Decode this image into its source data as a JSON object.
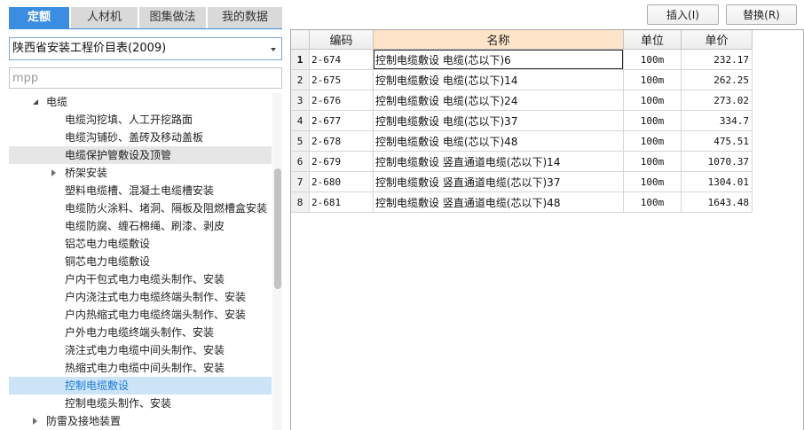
{
  "tabs": [
    {
      "label": "定额",
      "active": true
    },
    {
      "label": "人材机",
      "active": false
    },
    {
      "label": "图集做法",
      "active": false
    },
    {
      "label": "我的数据",
      "active": false
    }
  ],
  "library_select": {
    "value": "陕西省安装工程价目表(2009)",
    "icon": "chevron-down-icon"
  },
  "search": {
    "placeholder": "mpp"
  },
  "tree": {
    "items": [
      {
        "label": "电缆",
        "level": 0,
        "expander": "expanded"
      },
      {
        "label": "电缆沟挖填、人工开挖路面",
        "level": 1
      },
      {
        "label": "电缆沟铺砂、盖砖及移动盖板",
        "level": 1
      },
      {
        "label": "电缆保护管敷设及顶管",
        "level": 1,
        "state": "hover"
      },
      {
        "label": "桥架安装",
        "level": 1,
        "expander": "collapsed"
      },
      {
        "label": "塑料电缆槽、混凝土电缆槽安装",
        "level": 1
      },
      {
        "label": "电缆防火涂料、堵洞、隔板及阻燃槽盒安装",
        "level": 1
      },
      {
        "label": "电缆防腐、缠石棉绳、刷漆、剥皮",
        "level": 1
      },
      {
        "label": "铝芯电力电缆敷设",
        "level": 1
      },
      {
        "label": "铜芯电力电缆敷设",
        "level": 1
      },
      {
        "label": "户内干包式电力电缆头制作、安装",
        "level": 1
      },
      {
        "label": "户内浇注式电力电缆终端头制作、安装",
        "level": 1
      },
      {
        "label": "户内热缩式电力电缆终端头制作、安装",
        "level": 1
      },
      {
        "label": "户外电力电缆终端头制作、安装",
        "level": 1
      },
      {
        "label": "浇注式电力电缆中间头制作、安装",
        "level": 1
      },
      {
        "label": "热缩式电力电缆中间头制作、安装",
        "level": 1
      },
      {
        "label": "控制电缆敷设",
        "level": 1,
        "state": "selected"
      },
      {
        "label": "控制电缆头制作、安装",
        "level": 1
      },
      {
        "label": "防雷及接地装置",
        "level": 0,
        "expander": "collapsed"
      }
    ]
  },
  "toolbar": {
    "insert_label": "插入(I)",
    "replace_label": "替换(R)"
  },
  "table": {
    "columns": [
      {
        "key": "num",
        "label": ""
      },
      {
        "key": "code",
        "label": "编码"
      },
      {
        "key": "name",
        "label": "名称",
        "highlighted": true
      },
      {
        "key": "unit",
        "label": "单位"
      },
      {
        "key": "price",
        "label": "单价"
      }
    ],
    "rows": [
      {
        "num": "1",
        "code": "2-674",
        "name": "控制电缆敷设 电缆(芯以下)6",
        "unit": "100m",
        "price": "232.17"
      },
      {
        "num": "2",
        "code": "2-675",
        "name": "控制电缆敷设 电缆(芯以下)14",
        "unit": "100m",
        "price": "262.25"
      },
      {
        "num": "3",
        "code": "2-676",
        "name": "控制电缆敷设 电缆(芯以下)24",
        "unit": "100m",
        "price": "273.02"
      },
      {
        "num": "4",
        "code": "2-677",
        "name": "控制电缆敷设 电缆(芯以下)37",
        "unit": "100m",
        "price": "334.7"
      },
      {
        "num": "5",
        "code": "2-678",
        "name": "控制电缆敷设 电缆(芯以下)48",
        "unit": "100m",
        "price": "475.51"
      },
      {
        "num": "6",
        "code": "2-679",
        "name": "控制电缆敷设 竖直通道电缆(芯以下)14",
        "unit": "100m",
        "price": "1070.37"
      },
      {
        "num": "7",
        "code": "2-680",
        "name": "控制电缆敷设 竖直通道电缆(芯以下)37",
        "unit": "100m",
        "price": "1304.01"
      },
      {
        "num": "8",
        "code": "2-681",
        "name": "控制电缆敷设 竖直通道电缆(芯以下)48",
        "unit": "100m",
        "price": "1643.48"
      }
    ],
    "current_row": "1",
    "focused_column": "name"
  },
  "colors": {
    "accent": "#3a8de0",
    "tab_inactive": "#d9d9d9",
    "selected_bg": "#cce4f8",
    "selected_text": "#1f7bd6",
    "hover_bg": "#e6e6e6",
    "header_highlight": "#fde4c9"
  }
}
